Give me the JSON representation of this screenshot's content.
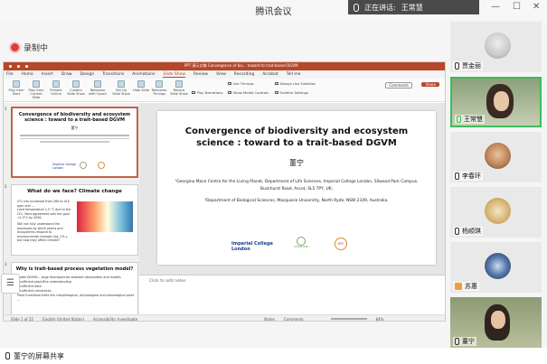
{
  "window": {
    "title": "腾讯会议",
    "speaker_prefix": "正在讲话:",
    "speaker_name": "王常慧"
  },
  "recording": {
    "label": "录制中"
  },
  "ppt": {
    "titlebar": "PPT 演示文稿 Convergence of bio... toward to trait-based DGVM",
    "tabs": [
      "File",
      "Home",
      "Insert",
      "Draw",
      "Design",
      "Transitions",
      "Animations",
      "Slide Show",
      "Review",
      "View",
      "Recording",
      "Acrobat",
      "Tell me"
    ],
    "active_tab": "Slide Show",
    "ribbon_buttons": [
      "Play from Start",
      "Play from Current Slide",
      "Present Online",
      "Custom Slide Show",
      "Rehearse with Coach",
      "Set Up Slide Show",
      "Hide Slide",
      "Rehearse Timings",
      "Record Slide Show"
    ],
    "ribbon_checks": [
      "Play Narrations",
      "Use Timings",
      "Show Media Controls",
      "Always Use Subtitles",
      "Subtitle Settings"
    ],
    "comments": "Comments",
    "share": "Share",
    "slides": [
      {
        "num": "1",
        "title": "Convergence of biodiversity and ecosystem science : toward to a trait-based DGVM"
      },
      {
        "num": "2",
        "title": "What do we face? Climate change"
      },
      {
        "num": "3",
        "title": "Why is trait-based process vegetation model?"
      }
    ],
    "slide2_bullets": [
      "CO₂ has increased from 280 to 410 ppm and ...",
      "Land temperature 1.5 °C due to the CO₂. Paris agreement sets the goal <1.5°C by 2030.",
      "Still not fully understand the processes by which plants and ecosystems respond to environmental changes (eg. CO₂), but how they affect climate?"
    ],
    "slide3_bullets": [
      "Model DGVMs – large discrepancies between observation and models",
      "Insufficient plant/Eco understanding",
      "Insufficient data",
      "Insufficient constraints",
      "Plant functional traits link morphological, physiological and phenological plant ..."
    ],
    "main_slide": {
      "title": "Convergence of biodiversity and ecosystem science : toward to a trait-based DGVM",
      "author": "董宁",
      "affil1": "¹Georgina Mace Centre for the Living Planet, Department of Life Sciences, Imperial College London, Silwood Park Campus, Buckhurst Road, Ascot, SL5 7PY, UK;",
      "affil2": "²Department of Biological Sciences, Macquarie University, North Ryde, NSW 2109, Australia.",
      "logo1_line1": "Imperial College",
      "logo1_line2": "London",
      "logo2": "LEMONTREE",
      "logo3": "erc"
    },
    "notes_placeholder": "Click to add notes",
    "status_left": "Slide 1 of 22",
    "status_lang": "English (United States)",
    "status_access": "Accessibility: Investigate",
    "status_notes": "Notes",
    "status_comments": "Comments",
    "zoom": "84%"
  },
  "participants": [
    {
      "name": "贾金丽",
      "active": false
    },
    {
      "name": "王常慧",
      "active": true
    },
    {
      "name": "李春环",
      "active": false
    },
    {
      "name": "杨顺琪",
      "active": false
    },
    {
      "name": "苏惠",
      "active": false
    },
    {
      "name": "董宁",
      "active": false
    }
  ],
  "bottom": {
    "sharing": "董宁的屏幕共享"
  },
  "colors": {
    "ppt_accent": "#b7472a",
    "active_border": "#3cbc5a",
    "rec": "#e23b3b"
  }
}
